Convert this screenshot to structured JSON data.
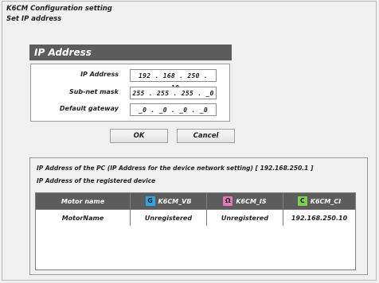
{
  "window": {
    "title": "K6CM Configuration setting",
    "subtitle": "Set IP address"
  },
  "ip_section": {
    "header": "IP Address",
    "fields": [
      {
        "label": "IP Address",
        "value": "192 . 168 . 250 . _10"
      },
      {
        "label": "Sub-net mask",
        "value": "255 . 255 . 255 . _0"
      },
      {
        "label": "Default gateway",
        "value": "_0 . _0 . _0 . _0"
      }
    ]
  },
  "buttons": {
    "ok": "OK",
    "cancel": "Cancel"
  },
  "registered": {
    "pc_ip_text": "IP Address of the PC (IP Address for the device network setting)  [ 192.168.250.1 ]",
    "registered_heading": "IP Address of the registered device",
    "columns": [
      {
        "label": "Motor name",
        "icon": "",
        "icon_glyph": "",
        "icon_color": ""
      },
      {
        "label": "K6CM_VB",
        "icon": "vibration-sensor-icon",
        "icon_glyph": "G",
        "icon_color": "#2aa8e8"
      },
      {
        "label": "K6CM_IS",
        "icon": "insulation-sensor-icon",
        "icon_glyph": "Ω",
        "icon_color": "#e27ab8"
      },
      {
        "label": "K6CM_CI",
        "icon": "current-sensor-icon",
        "icon_glyph": "C",
        "icon_color": "#7fcf52"
      }
    ],
    "rows": [
      [
        "MotorName",
        "Unregistered",
        "Unregistered",
        "192.168.250.10"
      ]
    ]
  }
}
